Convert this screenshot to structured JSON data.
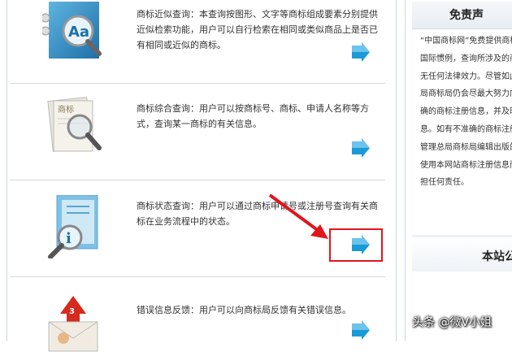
{
  "services": [
    {
      "icon": "similar-search-icon",
      "text": "商标近似查询：本查询按图形、文字等商标组成要素分别提供近似检索功能，用户可以自行检索在相同或类似商品上是否已有相同或近似的商标。"
    },
    {
      "icon": "comprehensive-search-icon",
      "text": "商标综合查询：用户可以按商标号、商标、申请人名称等方式，查询某一商标的有关信息。"
    },
    {
      "icon": "status-search-icon",
      "text": "商标状态查询：用户可以通过商标申请号或注册号查询有关商标在业务流程中的状态。"
    },
    {
      "icon": "error-feedback-icon",
      "text": "错误信息反馈：用户可以向商标局反馈有关错误信息。"
    }
  ],
  "sidebar": {
    "heading": "免责声",
    "lines": [
      "“中国商标网”免费提供商标",
      "国际惯例，查询所涉及的商标",
      "无任何法律效力。尽管如此",
      "局商标局仍会尽最大努力向",
      "确的商标注册信息，并及时",
      "息。如有不准确的商标注册",
      "管理总局商标局编辑出版的",
      "使用本网站商标注册信息而",
      "担任何责任。"
    ],
    "heading2": "本站公"
  },
  "watermark": "头条 @微V小姐",
  "colors": {
    "accent_blue": "#1a9ad6",
    "highlight_red": "#e0161c"
  }
}
